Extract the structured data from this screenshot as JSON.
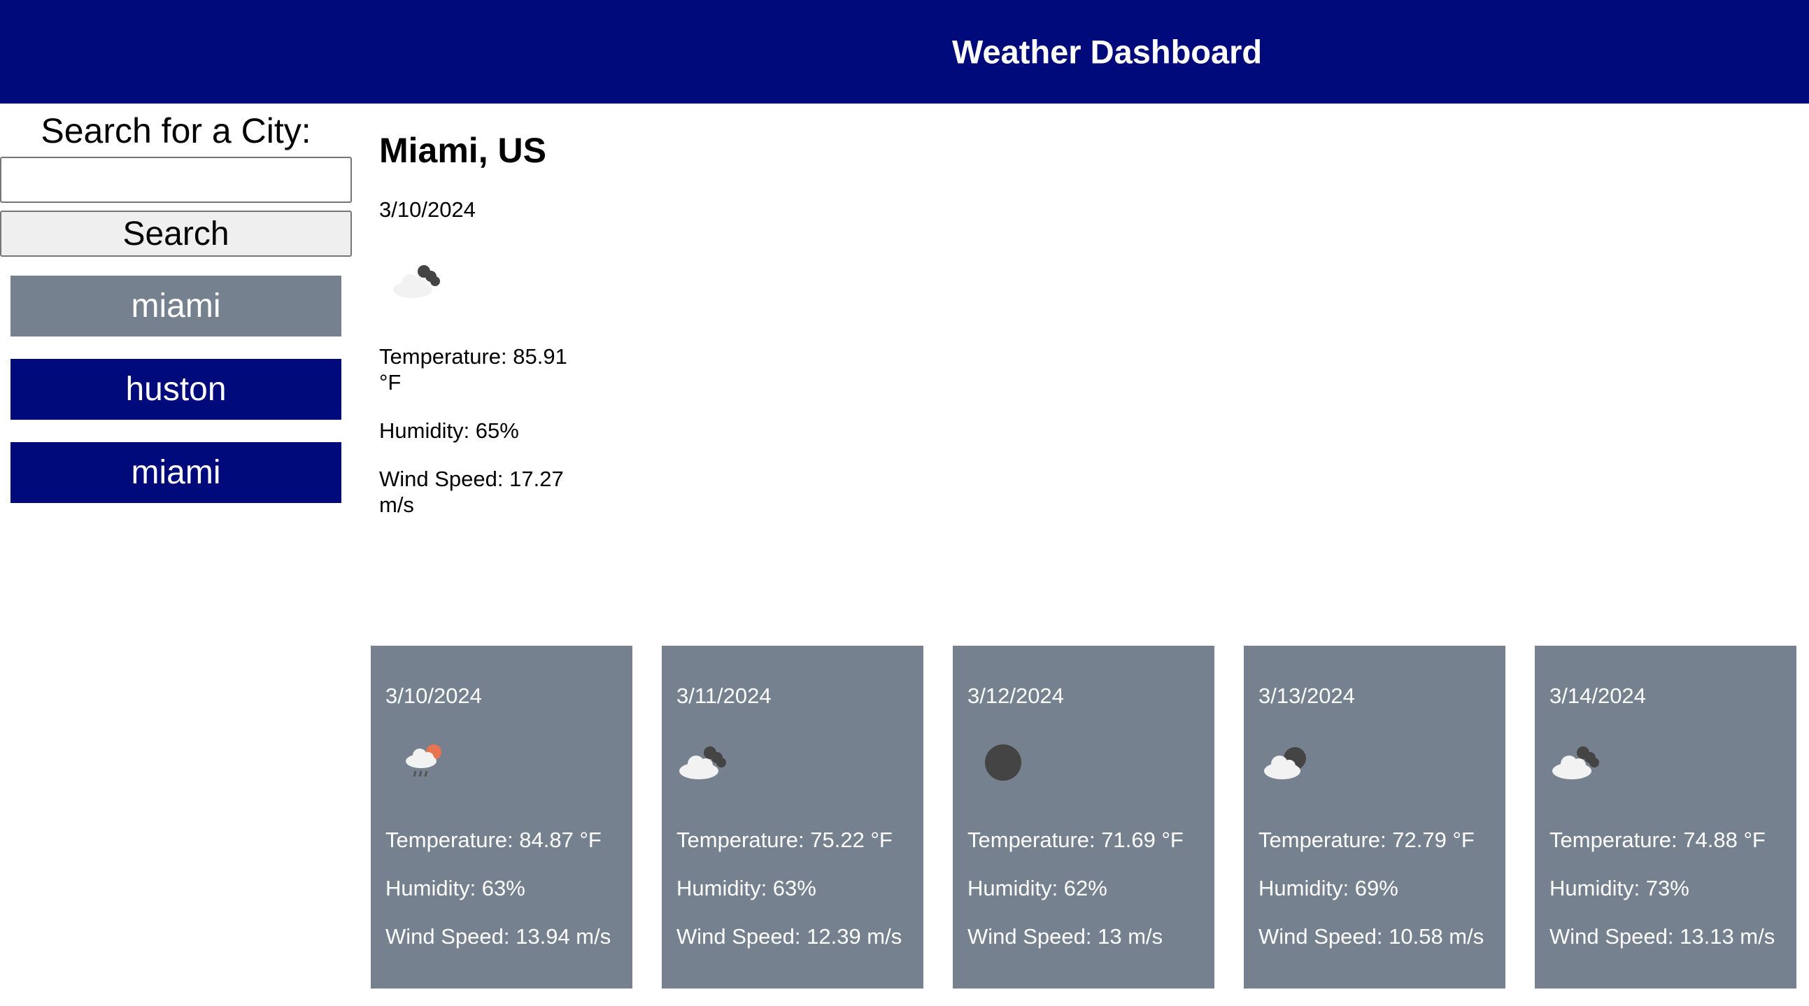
{
  "header": {
    "title": "Weather Dashboard"
  },
  "sidebar": {
    "search_label": "Search for a City:",
    "search_value": "",
    "search_button": "Search",
    "history": [
      {
        "label": "miami",
        "state": "active"
      },
      {
        "label": "huston",
        "state": "inactive"
      },
      {
        "label": "miami",
        "state": "inactive"
      }
    ]
  },
  "current": {
    "city": "Miami, US",
    "date": "3/10/2024",
    "icon": "broken-clouds-icon",
    "temperature": "Temperature: 85.91 °F",
    "humidity": "Humidity: 65%",
    "wind": "Wind Speed: 17.27 m/s"
  },
  "forecast": [
    {
      "date": "3/10/2024",
      "icon": "rain-sun-icon",
      "temperature": "Temperature: 84.87 °F",
      "humidity": "Humidity: 63%",
      "wind": "Wind Speed: 13.94 m/s"
    },
    {
      "date": "3/11/2024",
      "icon": "broken-clouds-icon",
      "temperature": "Temperature: 75.22 °F",
      "humidity": "Humidity: 63%",
      "wind": "Wind Speed: 12.39 m/s"
    },
    {
      "date": "3/12/2024",
      "icon": "clear-night-icon",
      "temperature": "Temperature: 71.69 °F",
      "humidity": "Humidity: 62%",
      "wind": "Wind Speed: 13 m/s"
    },
    {
      "date": "3/13/2024",
      "icon": "cloudy-night-icon",
      "temperature": "Temperature: 72.79 °F",
      "humidity": "Humidity: 69%",
      "wind": "Wind Speed: 10.58 m/s"
    },
    {
      "date": "3/14/2024",
      "icon": "broken-clouds-icon",
      "temperature": "Temperature: 74.88 °F",
      "humidity": "Humidity: 73%",
      "wind": "Wind Speed: 13.13 m/s"
    }
  ],
  "colors": {
    "header_bg": "#000a7a",
    "card_bg": "#75818f",
    "history_active": "#75818f",
    "history_inactive": "#000a7a"
  }
}
